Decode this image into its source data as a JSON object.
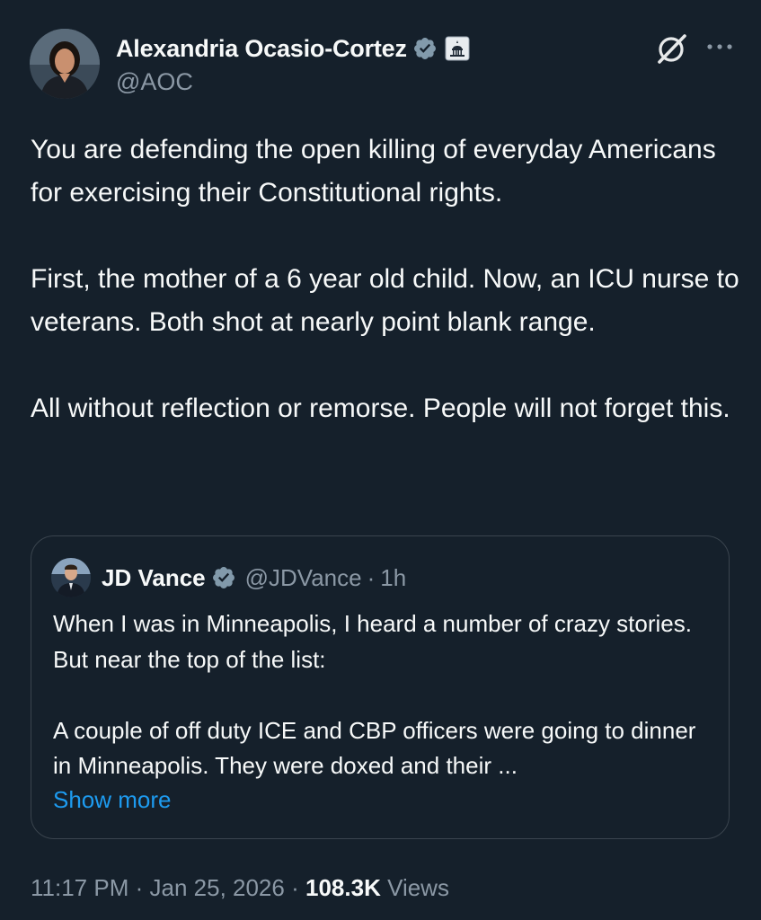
{
  "tweet": {
    "author": {
      "display_name": "Alexandria Ocasio-Cortez",
      "handle": "@AOC",
      "avatar_icon": "profile-photo",
      "verified_icon": "verified-badge-icon",
      "affiliation_icon": "capitol-building-icon"
    },
    "header_actions": {
      "grok_icon": "grok-icon",
      "more_icon": "more-options-icon"
    },
    "text": "You are defending the open killing of everyday Americans for exercising their Constitutional rights.\n\nFirst, the mother of a 6 year old child. Now, an ICU nurse to veterans. Both shot at nearly point blank range.\n\nAll without reflection or remorse. People will not forget this.",
    "quoted": {
      "display_name": "JD Vance",
      "handle": "@JDVance",
      "separator": "·",
      "time": "1h",
      "text": "When I was in Minneapolis, I heard a number of crazy stories. But near the top of the list:\n\nA couple of off duty ICE and CBP officers were going to dinner in Minneapolis. They were doxed and their ...",
      "show_more": "Show more"
    },
    "meta": {
      "time": "11:17 PM",
      "separator": "·",
      "date": "Jan 25, 2026",
      "views_count": "108.3K",
      "views_label": "Views"
    }
  },
  "colors": {
    "background": "#15202b",
    "text_primary": "#f7f9f9",
    "text_secondary": "#8b98a5",
    "link": "#1d9bf0",
    "verified_badge": "#829aab",
    "border": "#3a444e"
  }
}
